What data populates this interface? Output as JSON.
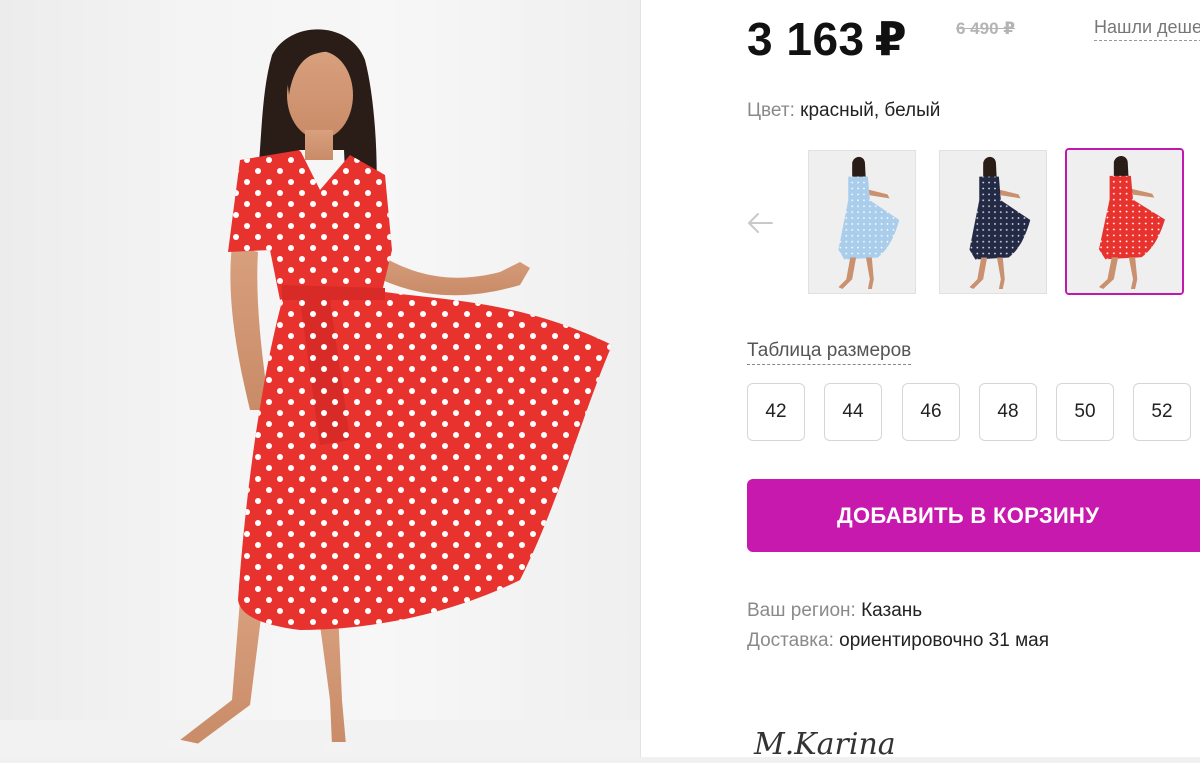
{
  "product": {
    "price": "3 163",
    "currency": "₽",
    "old_price": "6 490 ₽",
    "cheaper_link": "Нашли дешевле?",
    "color_label": "Цвет:",
    "color_value": "красный, белый"
  },
  "thumbnails": [
    {
      "name": "light-blue",
      "dress_color": "#a9cdea",
      "dot_color": "#ffffff",
      "selected": false
    },
    {
      "name": "navy",
      "dress_color": "#232a45",
      "dot_color": "#e8e8e8",
      "selected": false
    },
    {
      "name": "red",
      "dress_color": "#e8322e",
      "dot_color": "#ffffff",
      "selected": true
    }
  ],
  "sizes": {
    "table_link": "Таблица размеров",
    "options": [
      "42",
      "44",
      "46",
      "48",
      "50",
      "52"
    ]
  },
  "cart": {
    "label": "ДОБАВИТЬ В КОРЗИНУ"
  },
  "delivery": {
    "region_label": "Ваш регион:",
    "region_value": "Казань",
    "delivery_label": "Доставка:",
    "delivery_value": "ориентировочно 31 мая"
  },
  "brand": {
    "logo_text": "M.Karina"
  },
  "colors": {
    "accent": "#c819ae",
    "selected_border": "#c118ad",
    "dress_red": "#e8322e",
    "muted_text": "#8a8a8a"
  },
  "icons": {
    "prev": "arrow-left-icon"
  }
}
